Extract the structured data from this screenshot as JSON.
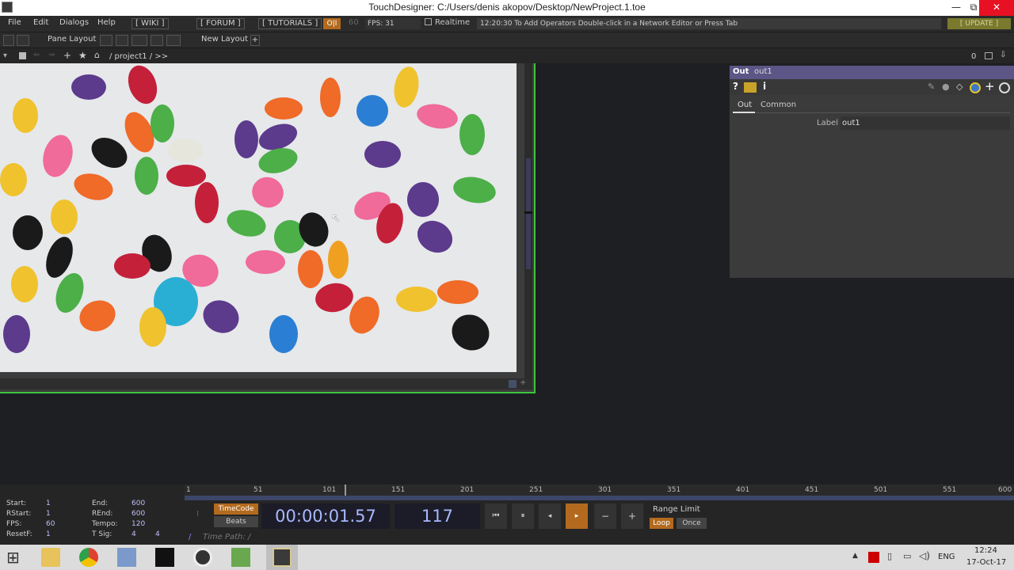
{
  "window": {
    "title": "TouchDesigner: C:/Users/denis akopov/Desktop/NewProject.1.toe",
    "min": "—",
    "max": "⧉",
    "close": "✕"
  },
  "menu": {
    "file": "File",
    "edit": "Edit",
    "dialogs": "Dialogs",
    "help": "Help",
    "wiki": "[ WIKI ]",
    "forum": "[ FORUM ]",
    "tutorials": "[ TUTORIALS ]",
    "oi": "O|I",
    "fps60": "60",
    "fps": "FPS:  31",
    "realtime": "Realtime",
    "message": "12:20:30 To Add Operators Double-click in a Network Editor or Press Tab",
    "update": "[ UPDATE ]"
  },
  "panebar": {
    "pane_layout": "Pane Layout",
    "new_layout": "New Layout",
    "plus": "+"
  },
  "pathbar": {
    "path": "/ project1 / >>",
    "zero": "0"
  },
  "params": {
    "op_type": "Out",
    "op_name": "out1",
    "tab_out": "Out",
    "tab_common": "Common",
    "label_key": "Label",
    "label_value": "out1"
  },
  "timeline": {
    "start_k": "Start:",
    "start_v": "1",
    "rstart_k": "RStart:",
    "rstart_v": "1",
    "fps_k": "FPS:",
    "fps_v": "60",
    "resetf_k": "ResetF:",
    "resetf_v": "1",
    "end_k": "End:",
    "end_v": "600",
    "rend_k": "REnd:",
    "rend_v": "600",
    "tempo_k": "Tempo:",
    "tempo_v": "120",
    "tsig_k": "T Sig:",
    "tsig_v1": "4",
    "tsig_v2": "4",
    "timecode": "TimeCode",
    "beats": "Beats",
    "time": "00:00:01.57",
    "frame": "117",
    "range_limit": "Range Limit",
    "loop": "Loop",
    "once": "Once",
    "time_path": "Time Path: /",
    "slash": "/",
    "ticks": [
      "1",
      "51",
      "101",
      "151",
      "201",
      "251",
      "301",
      "351",
      "401",
      "451",
      "501",
      "551",
      "600"
    ]
  },
  "taskbar": {
    "lang": "ENG",
    "time": "12:24",
    "date": "17-Oct-17"
  }
}
